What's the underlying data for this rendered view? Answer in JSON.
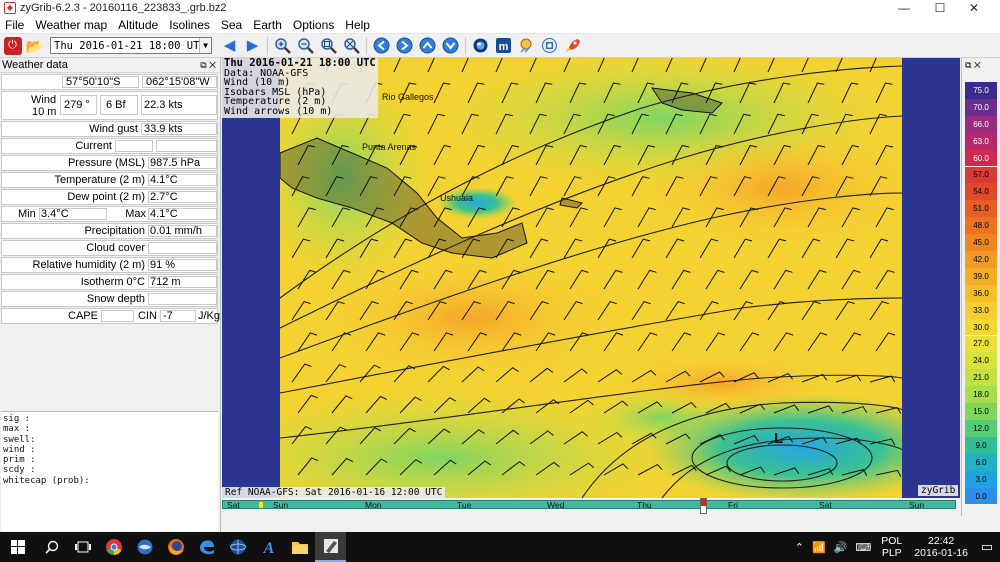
{
  "window": {
    "title": "zyGrib-6.2.3 - 20160116_223833_.grb.bz2",
    "minimize": "—",
    "maximize": "☐",
    "close": "✕"
  },
  "menu": [
    "File",
    "Weather map",
    "Altitude",
    "Isolines",
    "Sea",
    "Earth",
    "Options",
    "Help"
  ],
  "toolbar": {
    "date_select": "Thu 2016-01-21 18:00 UTC",
    "icons": [
      "power-icon",
      "open-file-icon",
      "previous-icon",
      "next-icon",
      "zoom-in-icon",
      "zoom-out-icon",
      "zoom-fit-icon",
      "zoom-selection-icon",
      "arrow-left-icon",
      "arrow-right-icon",
      "arrow-up-icon",
      "arrow-down-icon",
      "globe-icon",
      "meteogram-icon",
      "animation-icon",
      "globe-satellite-icon",
      "rocket-icon"
    ]
  },
  "panel": {
    "title": "Weather data",
    "lat": "57°50'10\"S",
    "lon": "062°15'08\"W",
    "wind_label": "Wind",
    "wind_sub": "10 m",
    "wind_dir": "279 °",
    "wind_bf": "6 Bf",
    "wind_kts": "22.3  kts",
    "gust_label": "Wind gust",
    "gust_val": "33.9  kts",
    "current_label": "Current",
    "pressure_label": "Pressure (MSL)",
    "pressure_val": "987.5 hPa",
    "temp_label": "Temperature (2 m)",
    "temp_val": "4.1°C",
    "dew_label": "Dew point (2 m)",
    "dew_val": "2.7°C",
    "min_label": "Min",
    "min_val": "3.4°C",
    "max_label": "Max",
    "max_val": "4.1°C",
    "precip_label": "Precipitation",
    "precip_val": "0.01 mm/h",
    "cloud_label": "Cloud cover",
    "rh_label": "Relative humidity (2 m)",
    "rh_val": "91 %",
    "iso_label": "Isotherm 0°C",
    "iso_val": "712 m",
    "snow_label": "Snow depth",
    "cape_label": "CAPE",
    "cin_label": "CIN",
    "cin_val": "-7",
    "jkg_label": "J/Kg"
  },
  "console_lines": [
    "sig  :",
    "max  :",
    "swell:",
    "wind :",
    "prim :",
    "scdy :",
    "whitecap (prob):"
  ],
  "map": {
    "info_title": "Thu 2016-01-21 18:00 UTC",
    "info_lines": [
      "Data: NOAA-GFS",
      "Wind (10 m)",
      "Isobars MSL (hPa)",
      "Temperature (2 m)",
      "Wind arrows (10 m)"
    ],
    "places": [
      "Rio Gallegos",
      "Ushuaia",
      "Punta Arenas"
    ],
    "low_label": "L",
    "ref": "Ref NOAA-GFS: Sat 2016-01-16 12:00 UTC",
    "brand": "zyGrib"
  },
  "timeline": {
    "days": [
      "Sat",
      "Sun",
      "Mon",
      "Tue",
      "Wed",
      "Thu",
      "Fri",
      "Sat",
      "Sun"
    ]
  },
  "scale": {
    "values": [
      "75.0",
      "70.0",
      "66.0",
      "63.0",
      "60.0",
      "57.0",
      "54.0",
      "51.0",
      "48.0",
      "45.0",
      "42.0",
      "39.0",
      "36.0",
      "33.0",
      "30.0",
      "27.0",
      "24.0",
      "21.0",
      "18.0",
      "15.0",
      "12.0",
      "9.0",
      "6.0",
      "3.0",
      "0.0"
    ],
    "colors": [
      "#3c2b8f",
      "#6b2e8e",
      "#982c80",
      "#b6286a",
      "#cc2a4e",
      "#d93a37",
      "#e04a2a",
      "#e55e24",
      "#ea7322",
      "#ee8722",
      "#f19b24",
      "#f3ad27",
      "#f6bf2a",
      "#f6cc2e",
      "#f2d833",
      "#e8df38",
      "#d7e23c",
      "#c2e243",
      "#a6df4d",
      "#7ed65c",
      "#56cb73",
      "#33bd97",
      "#23b0c0",
      "#1fa3de",
      "#2f8fe8"
    ]
  },
  "taskbar": {
    "lang1": "POL",
    "lang2": "PLP",
    "time": "22:42",
    "date": "2016-01-16"
  }
}
